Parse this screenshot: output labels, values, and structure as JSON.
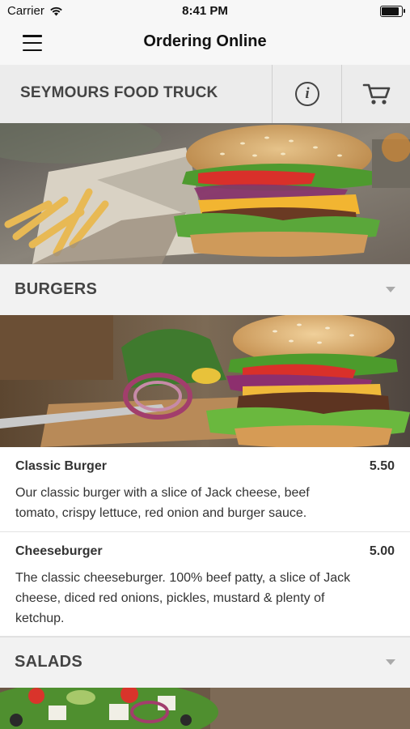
{
  "status_bar": {
    "carrier": "Carrier",
    "time": "8:41 PM"
  },
  "nav": {
    "title": "Ordering Online",
    "menu_icon": "hamburger-menu-icon"
  },
  "shop": {
    "name": "SEYMOURS FOOD TRUCK",
    "info_icon": "info-icon",
    "cart_icon": "cart-icon"
  },
  "categories": [
    {
      "title": "BURGERS",
      "items": [
        {
          "name": "Classic Burger",
          "price": "5.50",
          "description": "Our classic burger with a slice of Jack cheese, beef tomato, crispy lettuce, red onion and burger sauce."
        },
        {
          "name": "Cheeseburger",
          "price": "5.00",
          "description": "The classic cheeseburger. 100% beef patty, a slice of Jack cheese, diced red onions, pickles, mustard & plenty of ketchup."
        }
      ]
    },
    {
      "title": "SALADS",
      "items": []
    }
  ]
}
